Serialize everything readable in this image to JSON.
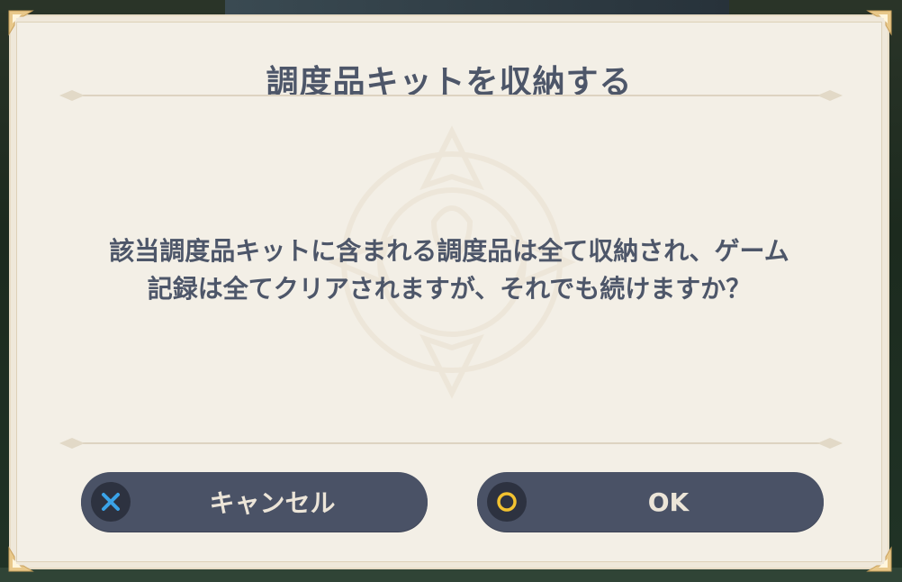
{
  "dialog": {
    "title": "調度品キットを収納する",
    "message_line1": "該当調度品キットに含まれる調度品は全て収納され、ゲーム",
    "message_line2": "記録は全てクリアされますが、それでも続けますか？"
  },
  "buttons": {
    "cancel_label": "キャンセル",
    "ok_label": "OK"
  },
  "icons": {
    "cancel": "cross-icon",
    "ok": "circle-icon"
  },
  "colors": {
    "panel_bg": "#f3efe6",
    "text": "#4d5669",
    "button_bg": "#4a5266",
    "button_text": "#ece5d8",
    "cross_accent": "#3aa3e8",
    "circle_accent": "#f2c230"
  }
}
